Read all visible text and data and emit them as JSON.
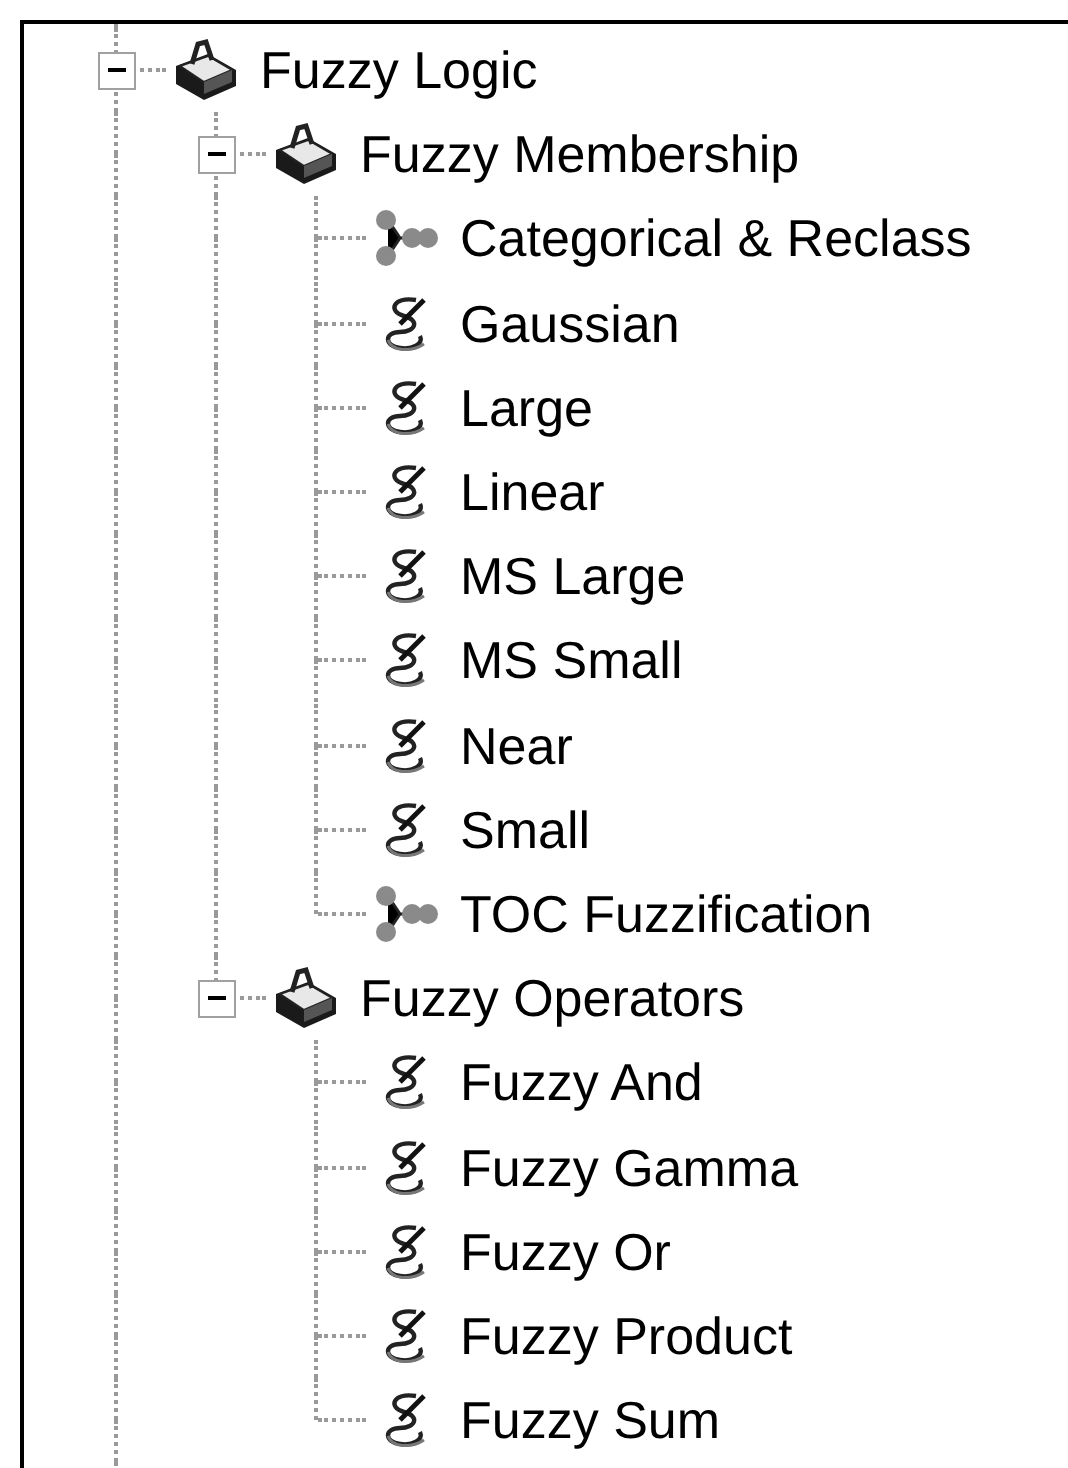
{
  "tree": [
    {
      "label": "Fuzzy Logic",
      "kind": "toolset",
      "expanded": true,
      "children": [
        {
          "label": "Fuzzy Membership",
          "kind": "toolset",
          "expanded": true,
          "children": [
            {
              "label": "Categorical & Reclass",
              "kind": "model"
            },
            {
              "label": "Gaussian",
              "kind": "script"
            },
            {
              "label": "Large",
              "kind": "script"
            },
            {
              "label": "Linear",
              "kind": "script"
            },
            {
              "label": "MS Large",
              "kind": "script"
            },
            {
              "label": "MS Small",
              "kind": "script"
            },
            {
              "label": "Near",
              "kind": "script"
            },
            {
              "label": "Small",
              "kind": "script"
            },
            {
              "label": "TOC Fuzzification",
              "kind": "model"
            }
          ]
        },
        {
          "label": "Fuzzy Operators",
          "kind": "toolset",
          "expanded": true,
          "children": [
            {
              "label": "Fuzzy And",
              "kind": "script"
            },
            {
              "label": "Fuzzy Gamma",
              "kind": "script"
            },
            {
              "label": "Fuzzy Or",
              "kind": "script"
            },
            {
              "label": "Fuzzy Product",
              "kind": "script"
            },
            {
              "label": "Fuzzy Sum",
              "kind": "script"
            }
          ]
        }
      ]
    }
  ]
}
